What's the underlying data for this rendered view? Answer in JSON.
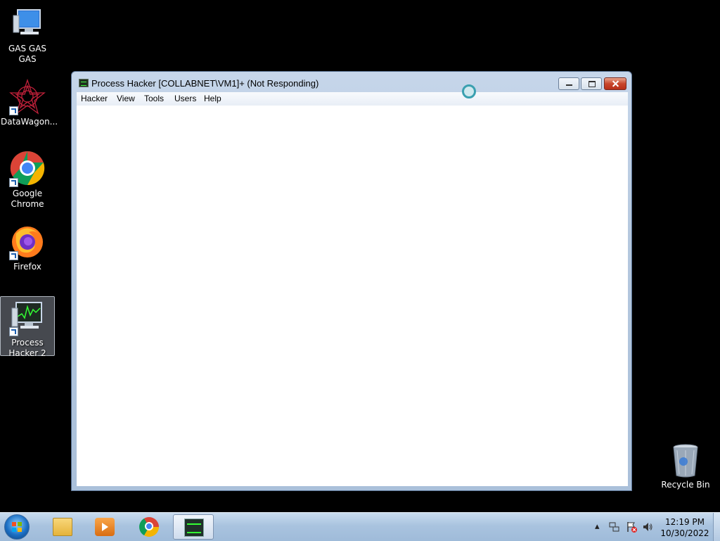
{
  "desktop": {
    "icons": [
      {
        "label": "GAS GAS GAS",
        "icon": "computer-icon"
      },
      {
        "label": "DataWagon...",
        "icon": "datawagon-icon"
      },
      {
        "label": "Google Chrome",
        "icon": "chrome-icon"
      },
      {
        "label": "Firefox",
        "icon": "firefox-icon"
      },
      {
        "label": "Process Hacker 2",
        "icon": "process-hacker-icon"
      },
      {
        "label": "Recycle Bin",
        "icon": "recycle-bin-icon"
      }
    ]
  },
  "window": {
    "title": "Process Hacker [COLLABNET\\VM1]+ (Not Responding)",
    "menu": [
      "Hacker",
      "View",
      "Tools",
      "Users",
      "Help"
    ]
  },
  "taskbar": {
    "pinned": [
      "windows-explorer-icon",
      "media-player-icon",
      "chrome-icon",
      "process-hacker-icon"
    ],
    "clock": {
      "time": "12:19 PM",
      "date": "10/30/2022"
    }
  },
  "colors": {
    "desktop_background": "#000000",
    "taskbar": "#a9c3df",
    "close_button": "#c8462c"
  }
}
